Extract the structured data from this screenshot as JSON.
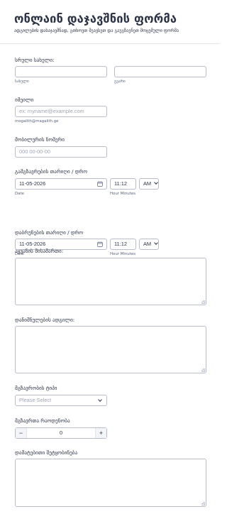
{
  "form": {
    "title": "ონლაინ დაჯავშნის ფორმა",
    "subtitle": "ადგილების დასაჯავშნად, გთხოვთ შეავსეთ და გაუგზავნეთ მოცემული ფორმა"
  },
  "fields": {
    "full_name": {
      "label": "სრული სახელი:",
      "first_sublabel": "სახელი",
      "last_sublabel": "გვარი",
      "first_value": "",
      "last_value": ""
    },
    "email": {
      "label": "იმეილი",
      "placeholder": "ex: myname@example.com",
      "sublabel": "mogalith@magalith.ge"
    },
    "phone": {
      "label": "მობილურის ნომერი",
      "placeholder": "000 00-00-00"
    },
    "departure": {
      "label": "გამგზავრების თარიღი / დრო",
      "date": "11-05-2026",
      "time": "11:12",
      "ampm": "AM",
      "date_sublabel": "Date",
      "time_sublabel": "Hour Minutes"
    },
    "return": {
      "label": "დაბრუნების თარიღი / დრო",
      "date": "11-05-2026",
      "time": "11:12",
      "ampm": "AM",
      "date_sublabel": "Date",
      "time_sublabel": "Hour Minutes"
    },
    "pickup_address": {
      "label": "აყვანის მისამართი:",
      "value": ""
    },
    "destination": {
      "label": "დანიშნულების ადგილი:",
      "value": ""
    },
    "trip_type": {
      "label": "მგზავრობის ტიპი",
      "placeholder": "Please Select"
    },
    "passengers": {
      "label": "მგზავრთა რაოდენობა",
      "minus": "−",
      "value": "0",
      "plus": "+"
    },
    "notes": {
      "label": "დამატებითი შეტყობინება",
      "value": ""
    }
  },
  "icons": {
    "calendar": "calendar-icon",
    "chevron": "chevron-down-icon",
    "resize": "resize-grip-icon"
  },
  "colors": {
    "text": "#2c3345",
    "muted": "#57647e",
    "border": "#b8bdc9",
    "placeholder": "#a0a6b4"
  }
}
